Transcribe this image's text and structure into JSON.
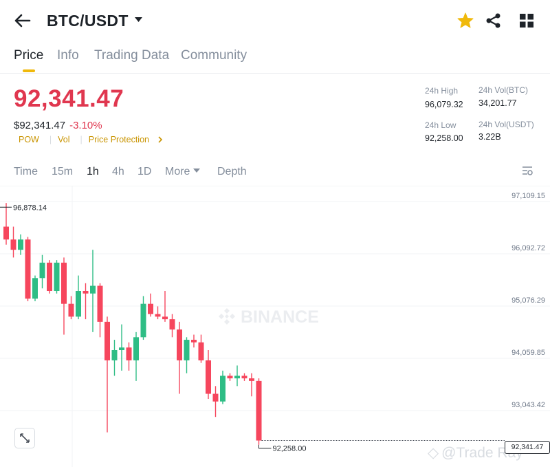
{
  "header": {
    "pair": "BTC/USDT"
  },
  "tabs": [
    "Price",
    "Info",
    "Trading Data",
    "Community"
  ],
  "ticker": {
    "last_price": "92,341.47",
    "usd_price": "$92,341.47",
    "change": "-3.10%",
    "tags": [
      "POW",
      "Vol",
      "Price Protection"
    ],
    "high_label": "24h High",
    "high_value": "96,079.32",
    "low_label": "24h Low",
    "low_value": "92,258.00",
    "vol_btc_label": "24h Vol(BTC)",
    "vol_btc_value": "34,201.77",
    "vol_usdt_label": "24h Vol(USDT)",
    "vol_usdt_value": "3.22B"
  },
  "timeframes": [
    "Time",
    "15m",
    "1h",
    "4h",
    "1D",
    "More",
    "Depth"
  ],
  "watermarks": {
    "exchange": "BINANCE",
    "credit": "@Trade Ray"
  },
  "colors": {
    "up": "#2ebd85",
    "down": "#f6465d",
    "accent": "#f0b90b",
    "price_red": "#e0374f"
  },
  "chart_data": {
    "type": "candlestick",
    "y_ticks": [
      "97,109.15",
      "96,092.72",
      "95,076.29",
      "94,059.85",
      "93,043.42"
    ],
    "y_tick_values": [
      97109.15,
      96092.72,
      95076.29,
      94059.85,
      93043.42
    ],
    "ylim": [
      92000,
      97350
    ],
    "high_marker": "96,878.14",
    "low_marker": "92,258.00",
    "current_price": "92,341.47",
    "candles": [
      {
        "o": 96500,
        "h": 96960,
        "c": 96250,
        "l": 96150
      },
      {
        "o": 96250,
        "h": 96500,
        "c": 96050,
        "l": 95900
      },
      {
        "o": 96050,
        "h": 96350,
        "c": 96250,
        "l": 95950
      },
      {
        "o": 96250,
        "h": 96300,
        "c": 95100,
        "l": 95050
      },
      {
        "o": 95100,
        "h": 95550,
        "c": 95500,
        "l": 95050
      },
      {
        "o": 95500,
        "h": 95950,
        "c": 95800,
        "l": 95300
      },
      {
        "o": 95800,
        "h": 95850,
        "c": 95250,
        "l": 95200
      },
      {
        "o": 95250,
        "h": 95850,
        "c": 95800,
        "l": 95200
      },
      {
        "o": 95800,
        "h": 95900,
        "c": 95000,
        "l": 94400
      },
      {
        "o": 95000,
        "h": 95150,
        "c": 94750,
        "l": 94700
      },
      {
        "o": 94750,
        "h": 95550,
        "c": 95250,
        "l": 94700
      },
      {
        "o": 95250,
        "h": 95400,
        "c": 95200,
        "l": 94700
      },
      {
        "o": 95200,
        "h": 96050,
        "c": 95350,
        "l": 94450
      },
      {
        "o": 95350,
        "h": 95400,
        "c": 94650,
        "l": 94350
      },
      {
        "o": 94650,
        "h": 94750,
        "c": 93900,
        "l": 92500
      },
      {
        "o": 93900,
        "h": 94300,
        "c": 94100,
        "l": 93600
      },
      {
        "o": 94100,
        "h": 94600,
        "c": 94150,
        "l": 93700
      },
      {
        "o": 94150,
        "h": 94250,
        "c": 93900,
        "l": 93700
      },
      {
        "o": 93900,
        "h": 94450,
        "c": 94350,
        "l": 93500
      },
      {
        "o": 94350,
        "h": 95150,
        "c": 95000,
        "l": 94300
      },
      {
        "o": 95000,
        "h": 95200,
        "c": 94800,
        "l": 94750
      },
      {
        "o": 94800,
        "h": 94950,
        "c": 94750,
        "l": 94700
      },
      {
        "o": 94750,
        "h": 95250,
        "c": 94700,
        "l": 94650
      },
      {
        "o": 94700,
        "h": 94800,
        "c": 94500,
        "l": 94350
      },
      {
        "o": 94500,
        "h": 94650,
        "c": 93900,
        "l": 93250
      },
      {
        "o": 93900,
        "h": 94350,
        "c": 94300,
        "l": 93650
      },
      {
        "o": 94300,
        "h": 94400,
        "c": 94250,
        "l": 94150
      },
      {
        "o": 94250,
        "h": 94400,
        "c": 93900,
        "l": 93850
      },
      {
        "o": 93900,
        "h": 94100,
        "c": 93250,
        "l": 93150
      },
      {
        "o": 93250,
        "h": 93400,
        "c": 93100,
        "l": 92800
      },
      {
        "o": 93100,
        "h": 93700,
        "c": 93600,
        "l": 93050
      },
      {
        "o": 93600,
        "h": 93650,
        "c": 93550,
        "l": 93500
      },
      {
        "o": 93550,
        "h": 93800,
        "c": 93600,
        "l": 93400
      },
      {
        "o": 93600,
        "h": 93650,
        "c": 93550,
        "l": 93500
      },
      {
        "o": 93550,
        "h": 93650,
        "c": 93500,
        "l": 93200
      },
      {
        "o": 93500,
        "h": 93550,
        "c": 92341,
        "l": 92258
      }
    ]
  }
}
